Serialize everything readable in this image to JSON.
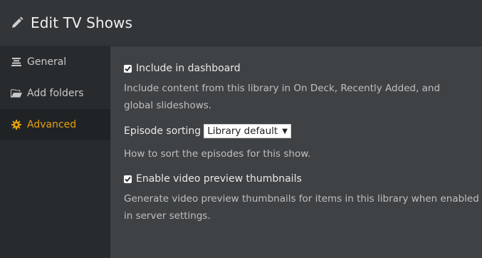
{
  "header": {
    "title": "Edit TV Shows",
    "icon": "pencil-icon"
  },
  "sidebar": {
    "items": [
      {
        "label": "General",
        "icon": "list-icon",
        "active": false
      },
      {
        "label": "Add folders",
        "icon": "folder-icon",
        "active": false
      },
      {
        "label": "Advanced",
        "icon": "gear-icon",
        "active": true
      }
    ]
  },
  "content": {
    "include_dashboard": {
      "label": "Include in dashboard",
      "checked": true,
      "help": "Include content from this library in On Deck, Recently Added, and global slideshows."
    },
    "episode_sorting": {
      "label": "Episode sorting",
      "value": "Library default",
      "help": "How to sort the episodes for this show."
    },
    "video_preview": {
      "label": "Enable video preview thumbnails",
      "checked": true,
      "help": "Generate video preview thumbnails for items in this library when enabled in server settings."
    }
  },
  "colors": {
    "accent": "#e5a00d",
    "header_bg": "#323639",
    "sidebar_bg": "#282b2e",
    "content_bg": "#3f4245"
  }
}
